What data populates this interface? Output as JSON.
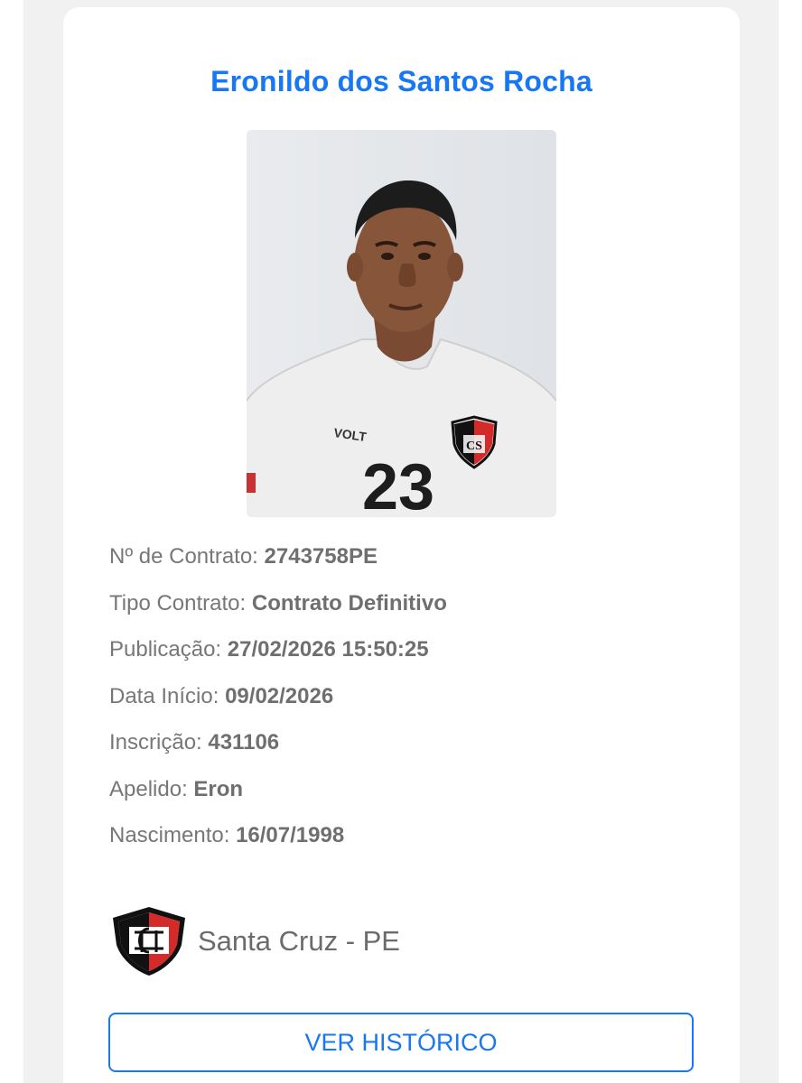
{
  "player": {
    "name": "Eronildo dos Santos Rocha",
    "photo_icon": "player-photo",
    "jersey_number": "23",
    "jersey_brand": "VOLT"
  },
  "details": [
    {
      "label": "Nº de Contrato:",
      "value": "2743758PE"
    },
    {
      "label": "Tipo Contrato:",
      "value": "Contrato Definitivo"
    },
    {
      "label": "Publicação:",
      "value": "27/02/2026 15:50:25"
    },
    {
      "label": "Data Início:",
      "value": "09/02/2026"
    },
    {
      "label": "Inscrição:",
      "value": "431106"
    },
    {
      "label": "Apelido:",
      "value": "Eron"
    },
    {
      "label": "Nascimento:",
      "value": "16/07/1998"
    }
  ],
  "club": {
    "name": "Santa Cruz - PE",
    "logo_icon": "santa-cruz-crest",
    "colors": {
      "red": "#d42a2a",
      "black": "#111111",
      "white": "#ffffff"
    }
  },
  "actions": {
    "history_label": "VER HISTÓRICO"
  },
  "theme": {
    "accent": "#1877f2",
    "text": "#777777"
  }
}
